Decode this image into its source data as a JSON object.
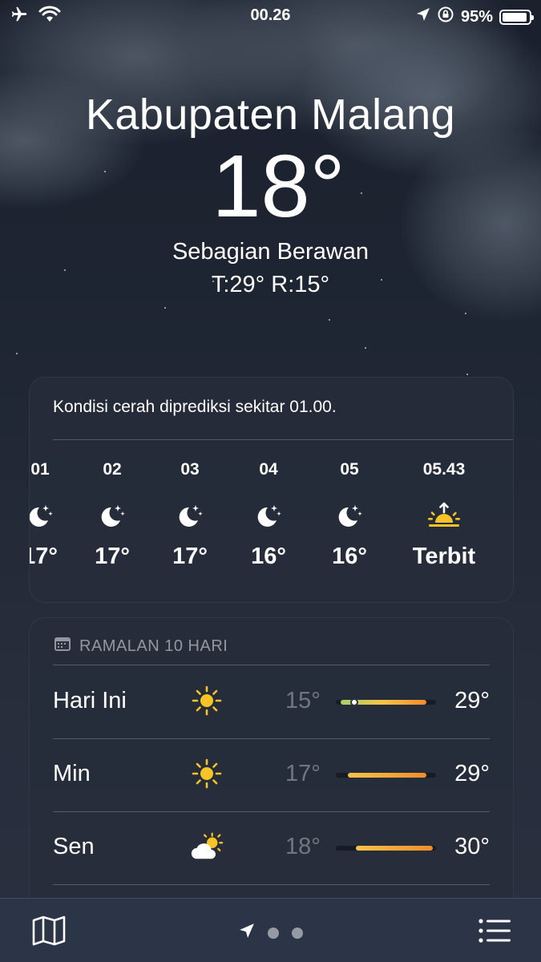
{
  "status_bar": {
    "time": "00.26",
    "battery": "95%",
    "battery_level": 0.95
  },
  "header": {
    "city": "Kabupaten Malang",
    "temperature": "18°",
    "condition": "Sebagian Berawan",
    "high_low": "T:29°  R:15°"
  },
  "hourly": {
    "summary": "Kondisi cerah diprediksi sekitar 01.00.",
    "items": [
      {
        "hour": "01",
        "temp": "17°",
        "icon": "moon-stars-icon"
      },
      {
        "hour": "02",
        "temp": "17°",
        "icon": "moon-stars-icon"
      },
      {
        "hour": "03",
        "temp": "17°",
        "icon": "moon-stars-icon"
      },
      {
        "hour": "04",
        "temp": "16°",
        "icon": "moon-stars-icon"
      },
      {
        "hour": "05",
        "temp": "16°",
        "icon": "moon-stars-icon"
      },
      {
        "hour": "05.43",
        "temp": "Terbit",
        "icon": "sunrise-icon"
      }
    ]
  },
  "forecast": {
    "title": "RAMALAN 10 HARI",
    "days": [
      {
        "day": "Hari Ini",
        "icon": "sun-icon",
        "low": "15°",
        "high": "29°",
        "range": [
          0.05,
          0.9
        ],
        "current": 0.18
      },
      {
        "day": "Min",
        "icon": "sun-icon",
        "low": "17°",
        "high": "29°",
        "range": [
          0.12,
          0.9
        ]
      },
      {
        "day": "Sen",
        "icon": "cloud-sun-icon",
        "low": "18°",
        "high": "30°",
        "range": [
          0.2,
          0.97
        ]
      }
    ]
  },
  "colors": {
    "sun": "#f7c325",
    "bar_cool": "#a8d06a",
    "bar_warm": "#f5c447",
    "bar_hot": "#f28c2c"
  }
}
